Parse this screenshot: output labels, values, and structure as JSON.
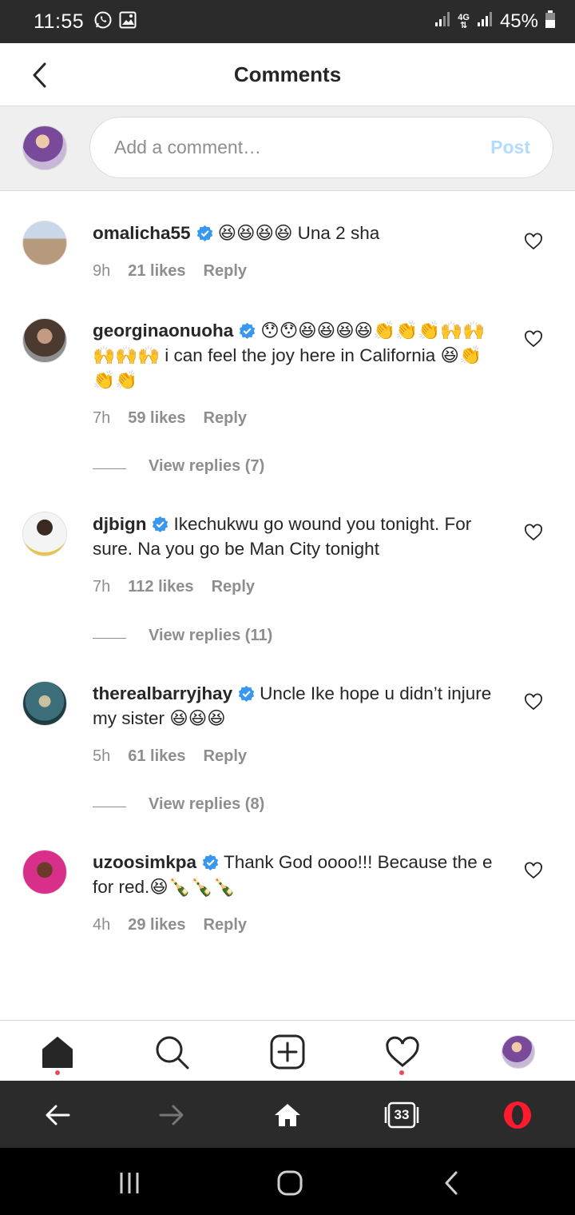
{
  "status_bar": {
    "time": "11:55",
    "network": "4G",
    "battery": "45%"
  },
  "header": {
    "title": "Comments"
  },
  "composer": {
    "placeholder": "Add a comment…",
    "post_label": "Post"
  },
  "comments": [
    {
      "username": "omalicha55",
      "text": "😆😆😆😆 Una 2 sha",
      "time": "9h",
      "likes": "21 likes",
      "reply_label": "Reply",
      "avatar_color": "#b79a7e"
    },
    {
      "username": "georginaonuoha",
      "text": "😯😯😆😆😆😆👏👏👏🙌🙌🙌🙌🙌 i can feel the joy here in California 😆👏👏👏",
      "time": "7h",
      "likes": "59 likes",
      "reply_label": "Reply",
      "view_replies": "View replies (7)",
      "avatar_color": "#6b5446"
    },
    {
      "username": "djbign",
      "text": "Ikechukwu go wound you tonight. For sure. Na you go be Man City tonight",
      "time": "7h",
      "likes": "112 likes",
      "reply_label": "Reply",
      "view_replies": "View replies (11)",
      "avatar_color": "#f2f2f2"
    },
    {
      "username": "therealbarryjhay",
      "text": "Uncle Ike hope u didn’t injure my sister 😆😆😆",
      "time": "5h",
      "likes": "61 likes",
      "reply_label": "Reply",
      "view_replies": "View replies (8)",
      "avatar_color": "#3d6f7a"
    },
    {
      "username": "uzoosimkpa",
      "text": "Thank God oooo!!! Because the e for red.😆🍾🍾🍾",
      "time": "4h",
      "likes": "29 likes",
      "reply_label": "Reply",
      "avatar_color": "#d8308a"
    }
  ],
  "bottom_nav": [
    "home-icon",
    "search-icon",
    "add-post-icon",
    "activity-heart-icon",
    "profile-avatar"
  ],
  "browser_bar": {
    "tabs_count": "33"
  },
  "colors": {
    "verified": "#3897f0",
    "post_disabled": "#b3dbff",
    "notification_dot": "#ed4956",
    "opera_red": "#ff1b2d"
  }
}
